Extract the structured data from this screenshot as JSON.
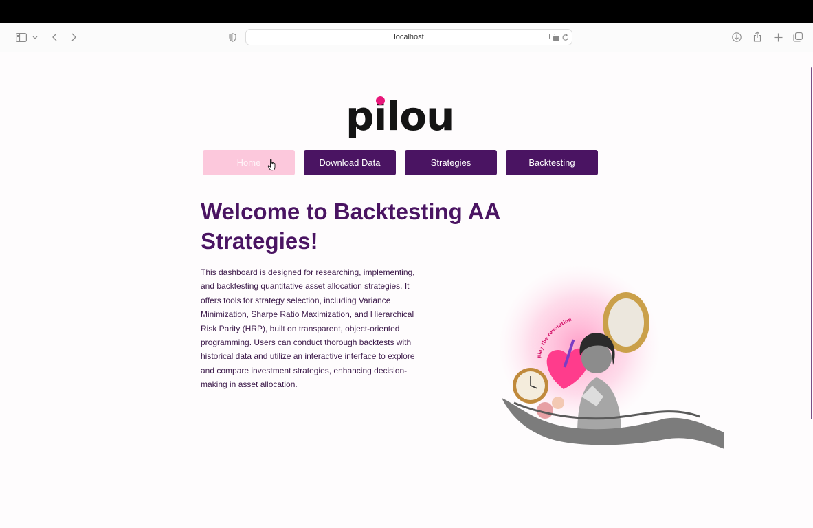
{
  "browser": {
    "url": "localhost"
  },
  "app": {
    "logo_text": "pilou",
    "nav": [
      {
        "label": "Home"
      },
      {
        "label": "Download Data"
      },
      {
        "label": "Strategies"
      },
      {
        "label": "Backtesting"
      }
    ],
    "headline": "Welcome to Backtesting AA Strategies!",
    "description": "This dashboard is designed for researching, implementing, and backtesting quantitative asset allocation strategies. It offers tools for strategy selection, including Variance Minimization, Sharpe Ratio Maximization, and Hierarchical Risk Parity (HRP), built on transparent, object-oriented programming. Users can conduct thorough backtests with historical data and utilize an interactive interface to explore and compare investment strategies, enhancing decision-making in asset allocation.",
    "illustration_text": "play the revolution"
  },
  "colors": {
    "primary": "#4a1462",
    "active_nav": "#fcc8dc",
    "logo_dot": "#e8177a",
    "page_bg": "#fefcfd"
  },
  "icons": [
    "sidebar-icon",
    "chevron-down-icon",
    "back-icon",
    "forward-icon",
    "shield-icon",
    "translate-icon",
    "reload-icon",
    "download-icon",
    "share-icon",
    "new-tab-icon",
    "tabs-overview-icon"
  ]
}
